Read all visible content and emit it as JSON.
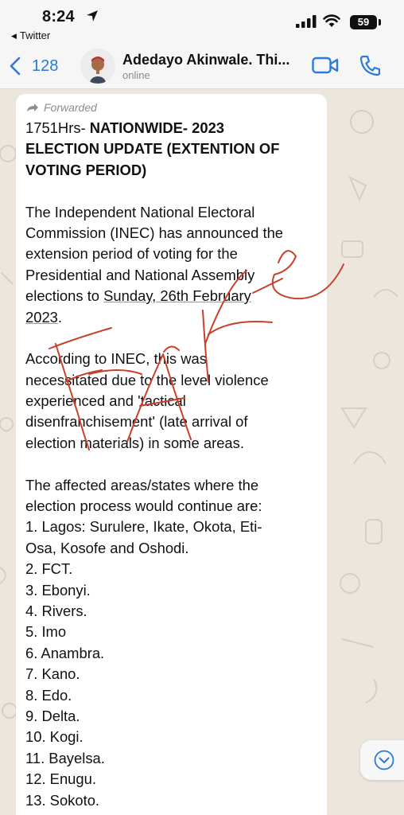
{
  "status_bar": {
    "time": "8:24",
    "back_app": "Twitter",
    "battery": "59"
  },
  "chat": {
    "back_count": "128",
    "contact_name": "Adedayo Akinwale. Thi...",
    "contact_status": "online"
  },
  "message": {
    "forwarded_label": "Forwarded",
    "title_lines": [
      {
        "plain": "1751Hrs- ",
        "bold": "NATIONWIDE- 2023"
      },
      {
        "plain": "",
        "bold": "ELECTION UPDATE (EXTENTION OF"
      },
      {
        "plain": "",
        "bold": "VOTING PERIOD)"
      }
    ],
    "paragraph1": [
      "The Independent National Electoral",
      "Commission (INEC) has announced the",
      "extension period of voting for the",
      "Presidential and National Assembly",
      "elections to ",
      "2023",
      "."
    ],
    "underlined_date_part1": "Sunday, 26th February",
    "paragraph2": [
      "According to INEC, this was",
      "necessitated due to the level violence",
      "experienced and 'tactical",
      "disenfranchisement' (late arrival of",
      "election materials) in some areas."
    ],
    "paragraph3": [
      "The affected areas/states where the",
      "election process would continue are:",
      "1. Lagos: Surulere, Ikate, Okota, Eti-",
      "Osa, Kosofe and Oshodi.",
      "2. FCT.",
      "3. Ebonyi.",
      "4. Rivers.",
      "5. Imo",
      "6. Anambra.",
      "7. Kano.",
      "8. Edo.",
      "9. Delta.",
      "10. Kogi.",
      "11. Bayelsa.",
      "12. Enugu.",
      "13. Sokoto."
    ]
  },
  "colors": {
    "accent": "#2b7ad6",
    "bubble": "#ffffff",
    "chat_background": "#ece6dd",
    "scribble": "#c9402a"
  }
}
